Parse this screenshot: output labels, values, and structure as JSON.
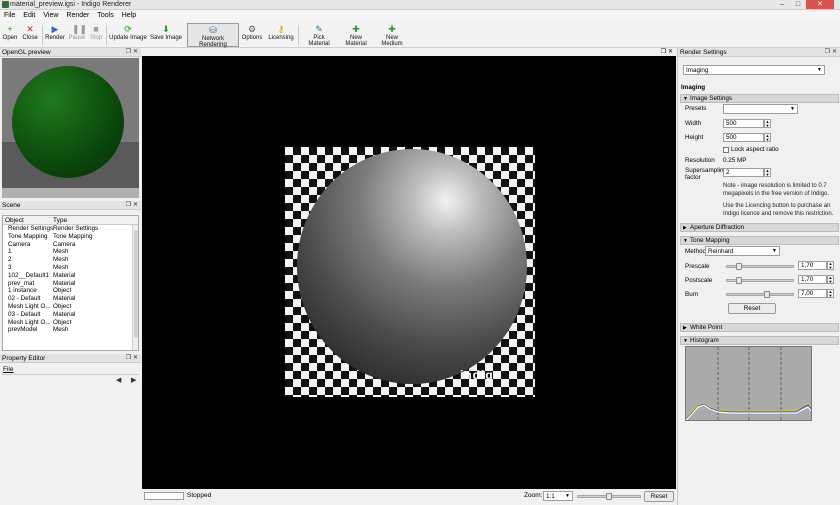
{
  "window": {
    "title": "material_preview.igsi - Indigo Renderer",
    "controls": [
      "–",
      "□",
      "✕"
    ]
  },
  "menubar": [
    "File",
    "Edit",
    "View",
    "Render",
    "Tools",
    "Help"
  ],
  "toolbar": [
    {
      "label": "Open",
      "icon": "plus-icon",
      "glyph": "+",
      "color": "#2a9a2a"
    },
    {
      "label": "Close",
      "icon": "close-icon",
      "glyph": "✕",
      "color": "#cc2222"
    },
    {
      "label": "Render",
      "icon": "play-icon",
      "glyph": "▶",
      "color": "#2a6fbf"
    },
    {
      "label": "Pause",
      "icon": "pause-icon",
      "glyph": "❚❚",
      "color": "#999999"
    },
    {
      "label": "Stop",
      "icon": "stop-icon",
      "glyph": "■",
      "color": "#999999"
    },
    {
      "label": "Update Image",
      "icon": "refresh-icon",
      "glyph": "⟳",
      "color": "#2a9a2a"
    },
    {
      "label": "Save Image",
      "icon": "save-icon",
      "glyph": "⬇",
      "color": "#2a9a2a"
    },
    {
      "label": "Network Rendering",
      "icon": "network-icon",
      "glyph": "⛁",
      "color": "#3a5f9a"
    },
    {
      "label": "Options",
      "icon": "gear-icon",
      "glyph": "⚙",
      "color": "#555555"
    },
    {
      "label": "Licensing",
      "icon": "key-icon",
      "glyph": "⚷",
      "color": "#c79a1a"
    },
    {
      "label": "Pick Material",
      "icon": "pick-icon",
      "glyph": "✎",
      "color": "#2a7a9a"
    },
    {
      "label": "New Material",
      "icon": "new-material-icon",
      "glyph": "✚",
      "color": "#2a9a2a"
    },
    {
      "label": "New Medium",
      "icon": "new-medium-icon",
      "glyph": "✚",
      "color": "#2a9a2a"
    }
  ],
  "opengl": {
    "title": "OpenGL preview"
  },
  "scene": {
    "title": "Scene",
    "columns": [
      "Object",
      "Type"
    ],
    "rows": [
      [
        "Render Settings",
        "Render Settings"
      ],
      [
        "Tone Mapping",
        "Tone Mapping"
      ],
      [
        "Camera",
        "Camera"
      ],
      [
        "1",
        "Mesh"
      ],
      [
        "2",
        "Mesh"
      ],
      [
        "3",
        "Mesh"
      ],
      [
        "102__Default1",
        "Material"
      ],
      [
        "prev_mat",
        "Material"
      ],
      [
        "1 instance",
        "Object"
      ],
      [
        "02 - Default",
        "Material"
      ],
      [
        "Mesh Light O...",
        "Object"
      ],
      [
        "03 - Default",
        "Material"
      ],
      [
        "Mesh Light O...",
        "Object"
      ],
      [
        "prevModel",
        "Mesh"
      ]
    ]
  },
  "property_editor": {
    "title": "Property Editor",
    "menu": "File",
    "nav": [
      "◀",
      "▶"
    ]
  },
  "render": {
    "logo": "indigo"
  },
  "statusbar": {
    "status": "Stopped",
    "zoom_label": "Zoom:",
    "zoom_value": "1:1",
    "reset": "Reset"
  },
  "settings": {
    "title": "Render Settings",
    "category": "Imaging",
    "heading": "Imaging",
    "image_settings": {
      "section": "Image Settings",
      "presets_label": "Presets",
      "presets_value": "",
      "width_label": "Width",
      "width": "500",
      "height_label": "Height",
      "height": "500",
      "lock": "Lock aspect ratio",
      "resolution_label": "Resolution",
      "resolution": "0.25 MP",
      "supersampling_label": "Supersampling factor",
      "supersampling": "2",
      "note1": "Note - image resolution is limited to 0.7 megapixels in the free version of Indigo.",
      "note2": "Use the Licencing button to purchase an Indigo licence and remove this restriction."
    },
    "aperture": "Aperture Diffraction",
    "tone_mapping": {
      "section": "Tone Mapping",
      "method_label": "Method",
      "method": "Reinhard",
      "prescale_label": "Prescale",
      "prescale": "1,70",
      "prescale_level": 0.15,
      "postscale_label": "Postscale",
      "postscale": "1,70",
      "postscale_level": 0.15,
      "burn_label": "Burn",
      "burn": "7,00",
      "burn_level": 0.6,
      "reset": "Reset"
    },
    "white_point": "White Point",
    "histogram": "Histogram"
  }
}
